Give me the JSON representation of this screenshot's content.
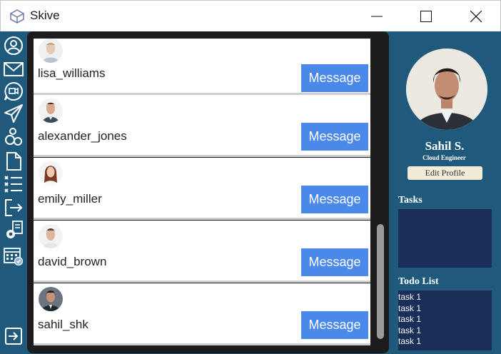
{
  "window": {
    "title": "Skive",
    "app_icon": "skive-logo-icon",
    "controls": [
      "minimize-icon",
      "maximize-icon",
      "close-icon"
    ]
  },
  "sidebar": {
    "items": [
      {
        "icon": "profile-icon"
      },
      {
        "icon": "mail-icon"
      },
      {
        "icon": "video-chat-icon"
      },
      {
        "icon": "send-icon"
      },
      {
        "icon": "users-icon"
      },
      {
        "icon": "document-icon"
      },
      {
        "icon": "task-list-icon"
      },
      {
        "icon": "logout-icon"
      },
      {
        "icon": "settings-documents-icon"
      },
      {
        "icon": "calendar-check-icon"
      }
    ],
    "bottom_icon": "expand-arrow-icon"
  },
  "users": [
    {
      "username": "lisa_williams",
      "button": "Message",
      "avatar": "female-avatar"
    },
    {
      "username": "alexander_jones",
      "button": "Message",
      "avatar": "male-avatar"
    },
    {
      "username": "emily_miller",
      "button": "Message",
      "avatar": "female-avatar"
    },
    {
      "username": "david_brown",
      "button": "Message",
      "avatar": "male-avatar"
    },
    {
      "username": "sahil_shk",
      "button": "Message",
      "avatar": "male-avatar"
    }
  ],
  "profile": {
    "name": "Sahil S.",
    "role": "Cloud Engineer",
    "edit_label": "Edit Profile",
    "tasks_heading": "Tasks",
    "todo_heading": "Todo List",
    "todo_items": [
      "task 1",
      "task 1",
      "task 1",
      "task 1",
      "task 1"
    ]
  },
  "colors": {
    "sidebar_bg": "#1f5a7d",
    "main_bg": "#1c1c1c",
    "button_blue": "#4a88ea",
    "panel_box": "#1a2f57",
    "edit_button": "#f1ebd8"
  }
}
